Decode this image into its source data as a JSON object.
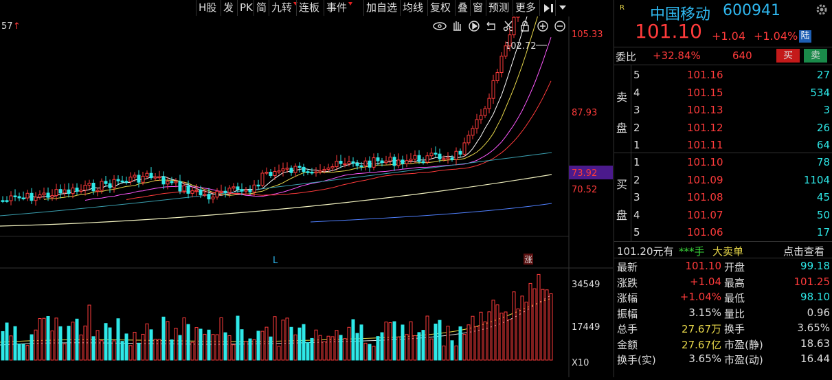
{
  "toolbar": {
    "items": [
      "H股",
      "发",
      "PK",
      "简",
      "九转",
      "连板",
      "事件",
      "加自选",
      "均线",
      "复权",
      "叠",
      "窗",
      "预测",
      "更多"
    ]
  },
  "chart": {
    "left_label": "57",
    "price_axis": [
      "105.33",
      "87.93",
      "73.92",
      "70.52"
    ],
    "vol_axis": [
      "34549",
      "17449",
      "X10"
    ],
    "hi_label": "102.72",
    "marker_L": "L",
    "marker_zhang": "涨"
  },
  "header": {
    "r_icon": "R",
    "name": "中国移动",
    "code": "600941",
    "price": "101.10",
    "change": "+1.04",
    "change_pct": "+1.04%",
    "market": "陆",
    "weibi_label": "委比",
    "weibi_value": "+32.84%",
    "weibi_diff": "640",
    "buy_btn": "买",
    "sell_btn": "卖"
  },
  "asks": {
    "side_label": [
      "卖",
      "盘"
    ],
    "rows": [
      {
        "lvl": "5",
        "price": "101.16",
        "vol": "27"
      },
      {
        "lvl": "4",
        "price": "101.15",
        "vol": "534"
      },
      {
        "lvl": "3",
        "price": "101.13",
        "vol": "3"
      },
      {
        "lvl": "2",
        "price": "101.12",
        "vol": "26"
      },
      {
        "lvl": "1",
        "price": "101.11",
        "vol": "64"
      }
    ]
  },
  "bids": {
    "side_label": [
      "买",
      "盘"
    ],
    "rows": [
      {
        "lvl": "1",
        "price": "101.10",
        "vol": "78"
      },
      {
        "lvl": "2",
        "price": "101.09",
        "vol": "1104"
      },
      {
        "lvl": "3",
        "price": "101.08",
        "vol": "45"
      },
      {
        "lvl": "4",
        "price": "101.07",
        "vol": "50"
      },
      {
        "lvl": "5",
        "price": "101.06",
        "vol": "17"
      }
    ]
  },
  "bigorder": {
    "price_text": "101.20元有",
    "stars": "***手",
    "label": "大卖单",
    "link": "点击查看"
  },
  "stats": [
    {
      "l1": "最新",
      "v1": "101.10",
      "c1": "red",
      "l2": "开盘",
      "v2": "99.18",
      "c2": "green"
    },
    {
      "l1": "涨跌",
      "v1": "+1.04",
      "c1": "red",
      "l2": "最高",
      "v2": "101.25",
      "c2": "red"
    },
    {
      "l1": "涨幅",
      "v1": "+1.04%",
      "c1": "red",
      "l2": "最低",
      "v2": "98.10",
      "c2": "green"
    },
    {
      "l1": "振幅",
      "v1": "3.15%",
      "c1": "white",
      "l2": "量比",
      "v2": "0.96",
      "c2": "white"
    },
    {
      "l1": "总手",
      "v1": "27.67万",
      "c1": "yellow",
      "l2": "换手",
      "v2": "3.65%",
      "c2": "white"
    },
    {
      "l1": "金额",
      "v1": "27.67亿",
      "c1": "yellow",
      "l2": "市盈(静)",
      "v2": "18.63",
      "c2": "white"
    },
    {
      "l1": "换手(实)",
      "v1": "3.65%",
      "c1": "white",
      "l2": "市盈(动)",
      "v2": "16.44",
      "c2": "white"
    }
  ],
  "colors": {
    "up": "#ff3b3b",
    "down": "#2ee8e8",
    "ma5": "#ffffff",
    "ma10": "#e8d84a",
    "ma20": "#ff59ff",
    "ma30": "#ff3b3b",
    "ma60": "#5080ff"
  }
}
